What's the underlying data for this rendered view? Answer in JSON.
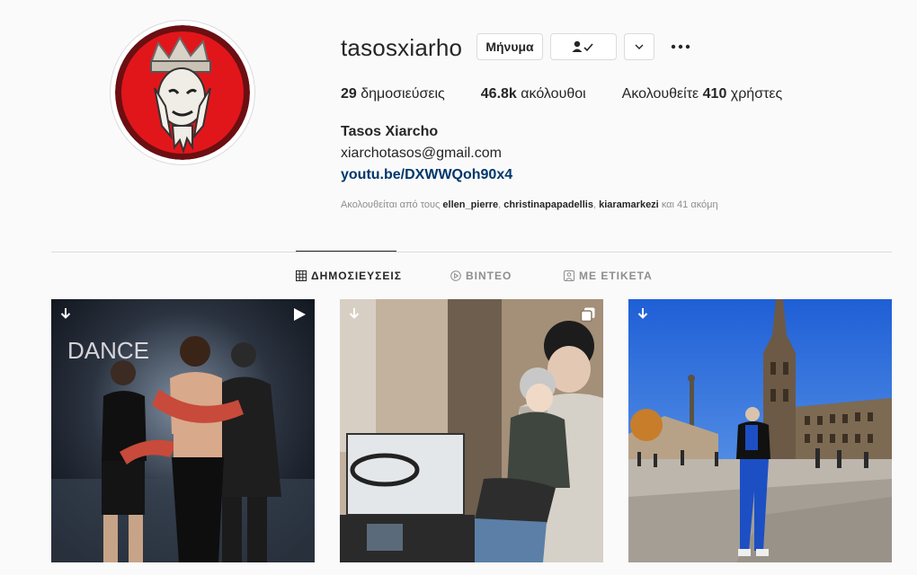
{
  "profile": {
    "username": "tasosxiarho",
    "full_name": "Tasos Xiarcho",
    "email": "xiarchotasos@gmail.com",
    "link": "youtu.be/DXWWQoh90x4",
    "avatar_icon": "crowned-face-avatar"
  },
  "actions": {
    "message_label": "Μήνυμα",
    "follow_icon": "person-check-icon",
    "more_icon": "chevron-down-icon",
    "options_icon": "more-horizontal-icon"
  },
  "stats": {
    "posts_count": "29",
    "posts_label": "δημοσιεύσεις",
    "followers_count": "46.8k",
    "followers_label": "ακόλουθοι",
    "following_prefix": "Ακολουθείτε",
    "following_count": "410",
    "following_suffix": "χρήστες"
  },
  "followed_by": {
    "prefix": "Ακολουθείται από τους",
    "users": [
      "ellen_pierre",
      "christinapapadellis",
      "kiaramarkezi"
    ],
    "suffix": "και 41 ακόμη"
  },
  "tabs": [
    {
      "label": "ΔΗΜΟΣΙΕΥΣΕΙΣ",
      "icon": "grid-icon",
      "active": true
    },
    {
      "label": "ΒΙΝΤΕΟ",
      "icon": "play-circle-icon",
      "active": false
    },
    {
      "label": "ΜΕ ΕΤΙΚΕΤΑ",
      "icon": "tag-icon",
      "active": false
    }
  ],
  "posts": [
    {
      "scene_text": "DANCE",
      "type_icon": "reel-icon",
      "download_icon": "download-icon",
      "colors": {
        "bg": "#1b2330",
        "accent": "#c84a3a"
      }
    },
    {
      "type_icon": "carousel-icon",
      "download_icon": "download-icon",
      "colors": {
        "bg": "#8a7a68",
        "accent": "#2c2c2c"
      }
    },
    {
      "type_icon": "none",
      "download_icon": "download-icon",
      "colors": {
        "bg": "#2a6fd1",
        "accent": "#1d4fc4"
      }
    }
  ],
  "colors": {
    "link": "#00376b",
    "muted": "#8e8e8e",
    "border": "#dbdbdb",
    "background": "#fafafa"
  }
}
